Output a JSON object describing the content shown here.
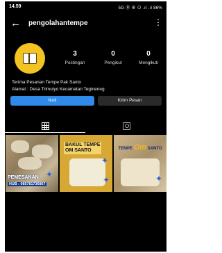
{
  "status": {
    "time": "14.59",
    "indicators": "5G Ⓡ ⊕ ⊙ .ıl .ıl 86%"
  },
  "header": {
    "username": "pengolahantempe"
  },
  "profile": {
    "posts_count": "3",
    "posts_label": "Postingan",
    "followers_count": "0",
    "followers_label": "Pengikut",
    "following_count": "0",
    "following_label": "Mengikuti",
    "bio_line1": "Terima Pesanan Tempe Pak Santo",
    "bio_line2": "Alamat : Desa Trimulyo Kecamatan Tegineneg"
  },
  "actions": {
    "follow_label": "Ikuti",
    "message_label": "Kirim Pesan"
  },
  "posts": {
    "p1_line1": "PEMESANAN",
    "p1_line2": "HUB : 085781736867",
    "p2_title_line1": "BAKUL TEMPE",
    "p2_title_line2": "OM SANTO",
    "p3_left": "TEMPE",
    "p3_om": "Om",
    "p3_right": "SANTO"
  },
  "colors": {
    "follow": "#2f8ae8",
    "accent_yellow": "#f3c322",
    "post_blue": "#123a8a"
  },
  "icons": [
    "back-arrow-icon",
    "more-vertical-icon",
    "grid-icon",
    "tagged-icon"
  ]
}
